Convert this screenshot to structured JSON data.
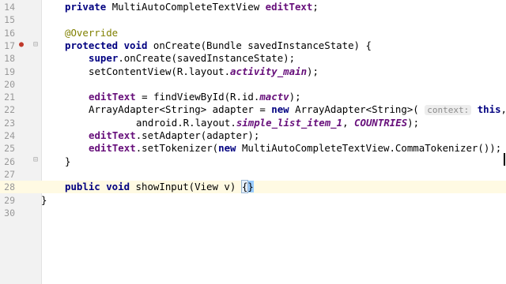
{
  "editor": {
    "lines": [
      {
        "number": "14",
        "indent": 1,
        "tokens": [
          [
            "kw",
            "private "
          ],
          [
            "",
            "MultiAutoCompleteTextView "
          ],
          [
            "field",
            "editText"
          ],
          [
            "",
            ";"
          ]
        ]
      },
      {
        "number": "15",
        "indent": 1,
        "tokens": []
      },
      {
        "number": "16",
        "indent": 1,
        "tokens": [
          [
            "ann",
            "@Override"
          ]
        ]
      },
      {
        "number": "17",
        "indent": 1,
        "tokens": [
          [
            "kw",
            "protected void "
          ],
          [
            "",
            "onCreate(Bundle savedInstanceState) {"
          ]
        ]
      },
      {
        "number": "18",
        "indent": 2,
        "tokens": [
          [
            "kw",
            "super"
          ],
          [
            "",
            ".onCreate(savedInstanceState);"
          ]
        ]
      },
      {
        "number": "19",
        "indent": 2,
        "tokens": [
          [
            "",
            "setContentView(R.layout."
          ],
          [
            "fieldi",
            "activity_main"
          ],
          [
            "",
            ");"
          ]
        ]
      },
      {
        "number": "20",
        "indent": 2,
        "tokens": []
      },
      {
        "number": "21",
        "indent": 2,
        "tokens": [
          [
            "field",
            "editText"
          ],
          [
            "",
            " = findViewById(R.id."
          ],
          [
            "fieldi",
            "mactv"
          ],
          [
            "",
            ");"
          ]
        ]
      },
      {
        "number": "22",
        "indent": 2,
        "tokens": [
          [
            "",
            "ArrayAdapter<String> adapter = "
          ],
          [
            "kw",
            "new "
          ],
          [
            "",
            "ArrayAdapter<String>( "
          ],
          [
            "hint",
            "context:"
          ],
          [
            "",
            " "
          ],
          [
            "kw",
            "this"
          ],
          [
            "",
            ","
          ]
        ]
      },
      {
        "number": "23",
        "indent": 4,
        "tokens": [
          [
            "",
            "android.R.layout."
          ],
          [
            "fieldi",
            "simple_list_item_1"
          ],
          [
            "",
            ", "
          ],
          [
            "fieldi",
            "COUNTRIES"
          ],
          [
            "",
            ");"
          ]
        ]
      },
      {
        "number": "24",
        "indent": 2,
        "tokens": [
          [
            "field",
            "editText"
          ],
          [
            "",
            ".setAdapter(adapter);"
          ]
        ]
      },
      {
        "number": "25",
        "indent": 2,
        "tokens": [
          [
            "field",
            "editText"
          ],
          [
            "",
            ".setTokenizer("
          ],
          [
            "kw",
            "new "
          ],
          [
            "",
            "MultiAutoCompleteTextView.CommaTokenizer());"
          ]
        ]
      },
      {
        "number": "26",
        "indent": 1,
        "tokens": [
          [
            "",
            "}"
          ]
        ]
      },
      {
        "number": "27",
        "indent": 1,
        "tokens": []
      },
      {
        "number": "28",
        "indent": 1,
        "current": true,
        "tokens": [
          [
            "kw",
            "public void "
          ],
          [
            "",
            "showInput(View v) "
          ],
          [
            "brace2",
            "{"
          ],
          [
            "brace",
            "}"
          ]
        ]
      },
      {
        "number": "29",
        "indent": 0,
        "tokens": [
          [
            "",
            "}"
          ]
        ]
      },
      {
        "number": "30",
        "indent": 0,
        "tokens": []
      }
    ]
  },
  "gutter_icons": {
    "line17_override": "override-marker-icon",
    "line17_fold": "fold-icon",
    "line26_fold": "fold-icon",
    "line21_fold": "fold-icon"
  },
  "colors": {
    "keyword": "#000080",
    "field": "#660e7a",
    "annotation": "#808000",
    "current_line": "#fffae3"
  }
}
